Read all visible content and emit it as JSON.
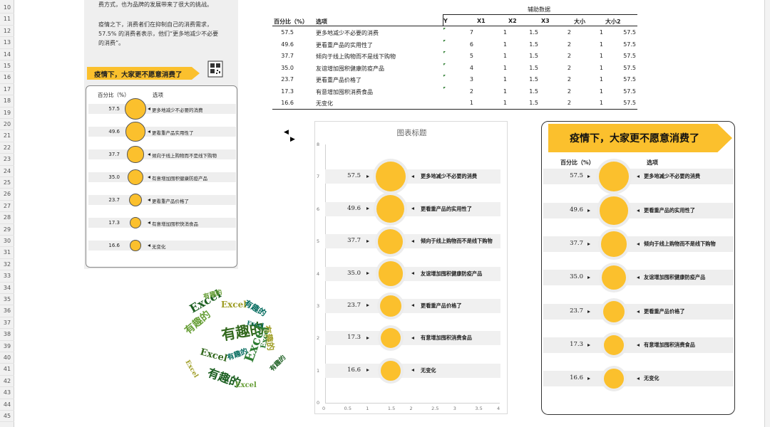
{
  "sheet": {
    "row_numbers": [
      "10",
      "11",
      "12",
      "13",
      "14",
      "15",
      "16",
      "17",
      "18",
      "19",
      "20",
      "21",
      "22",
      "23",
      "24",
      "25",
      "26",
      "27",
      "28",
      "29",
      "30",
      "31",
      "32",
      "33",
      "34",
      "35",
      "36",
      "37",
      "38",
      "39",
      "40",
      "41",
      "42",
      "43",
      "44",
      "45"
    ]
  },
  "panel1": {
    "intro_line1": "费方式，也为品牌的发展带来了很大的挑战。",
    "intro_line2": "疫情之下，消费者们在抑制自己的消费需求，",
    "intro_line3": "57.5% 的消费者表示，他们“更多地减少不必要",
    "intro_line4": "的消费”。",
    "banner": "疫情下，大家更不愿意消费了",
    "qr_icon": "qr-code-icon",
    "col_percent": "百分比（%）",
    "col_option": "选项",
    "values": [
      "57.5",
      "49.6",
      "37.7",
      "35.0",
      "23.7",
      "17.3",
      "16.6"
    ],
    "labels": [
      "更多地减少不必要的消费",
      "更看重产品实用性了",
      "倾向于线上购物而不是线下购物",
      "有意增加囤积健康防疫产品",
      "更看重产品价格了",
      "有意增加囤积快消食品",
      "无变化"
    ]
  },
  "table": {
    "aux_header": "辅助数据",
    "headers": [
      "百分比（%）",
      "选项",
      "Y",
      "X1",
      "X2",
      "X3",
      "大小",
      "大小2"
    ],
    "rows": [
      {
        "pct": "57.5",
        "option": "更多地减少不必要的消费",
        "y": "7",
        "x1": "1",
        "x2": "1.5",
        "x3": "2",
        "size": "1",
        "size2": "57.5"
      },
      {
        "pct": "49.6",
        "option": "更看重产品的实用性了",
        "y": "6",
        "x1": "1",
        "x2": "1.5",
        "x3": "2",
        "size": "1",
        "size2": "57.5"
      },
      {
        "pct": "37.7",
        "option": "倾向于线上购物而不是线下购物",
        "y": "5",
        "x1": "1",
        "x2": "1.5",
        "x3": "2",
        "size": "1",
        "size2": "57.5"
      },
      {
        "pct": "35.0",
        "option": "友谊增加囤积健康防疫产品",
        "y": "4",
        "x1": "1",
        "x2": "1.5",
        "x3": "2",
        "size": "1",
        "size2": "57.5"
      },
      {
        "pct": "23.7",
        "option": "更看重产品价格了",
        "y": "3",
        "x1": "1",
        "x2": "1.5",
        "x3": "2",
        "size": "1",
        "size2": "57.5"
      },
      {
        "pct": "17.3",
        "option": "有意增加囤积消费食品",
        "y": "2",
        "x1": "1",
        "x2": "1.5",
        "x3": "2",
        "size": "1",
        "size2": "57.5"
      },
      {
        "pct": "16.6",
        "option": "无变化",
        "y": "1",
        "x1": "1",
        "x2": "1.5",
        "x3": "2",
        "size": "1",
        "size2": "57.5"
      }
    ]
  },
  "wordcloud": {
    "words": [
      "Excel",
      "有趣的"
    ],
    "colors": [
      "#1b5e20",
      "#2e7d32",
      "#689f38",
      "#9e9d24",
      "#33691e",
      "#00695c"
    ]
  },
  "chart_data": {
    "type": "scatter",
    "title": "图表标题",
    "xlim": [
      0,
      4
    ],
    "ylim": [
      0,
      8
    ],
    "x_ticks": [
      "0",
      "0.5",
      "1",
      "1.5",
      "2",
      "2.5",
      "3",
      "3.5",
      "4"
    ],
    "y_ticks": [
      "0",
      "1",
      "2",
      "3",
      "4",
      "5",
      "6",
      "7",
      "8"
    ],
    "points": [
      {
        "y": 7,
        "value": 57.5,
        "pct_label": "57.5",
        "label": "更多地减少不必要的消费"
      },
      {
        "y": 6,
        "value": 49.6,
        "pct_label": "49.6",
        "label": "更看重产品的实用性了"
      },
      {
        "y": 5,
        "value": 37.7,
        "pct_label": "37.7",
        "label": "倾向于线上购物而不是线下购物"
      },
      {
        "y": 4,
        "value": 35.0,
        "pct_label": "35.0",
        "label": "友谊增加囤积健康防疫产品"
      },
      {
        "y": 3,
        "value": 23.7,
        "pct_label": "23.7",
        "label": "更看重产品价格了"
      },
      {
        "y": 2,
        "value": 17.3,
        "pct_label": "17.3",
        "label": "有意增加囤积消费食品"
      },
      {
        "y": 1,
        "value": 16.6,
        "pct_label": "16.6",
        "label": "无变化"
      }
    ],
    "bubble_color": "#fbc02d",
    "halo_color": "#ececec"
  },
  "panel3": {
    "banner": "疫情下，大家更不愿意消费了",
    "col_percent": "百分比（%）",
    "col_option": "选项",
    "values": [
      "57.5",
      "49.6",
      "37.7",
      "35.0",
      "23.7",
      "17.3",
      "16.6"
    ],
    "labels": [
      "更多地减少不必要的消费",
      "更看重产品的实用性了",
      "倾向于线上购物而不是线下购物",
      "友谊增加囤积健康防疫产品",
      "更看重产品价格了",
      "有意增加囤积消费食品",
      "无变化"
    ]
  },
  "colors": {
    "accent": "#fbc02d",
    "row_band": "#eeeeee"
  }
}
